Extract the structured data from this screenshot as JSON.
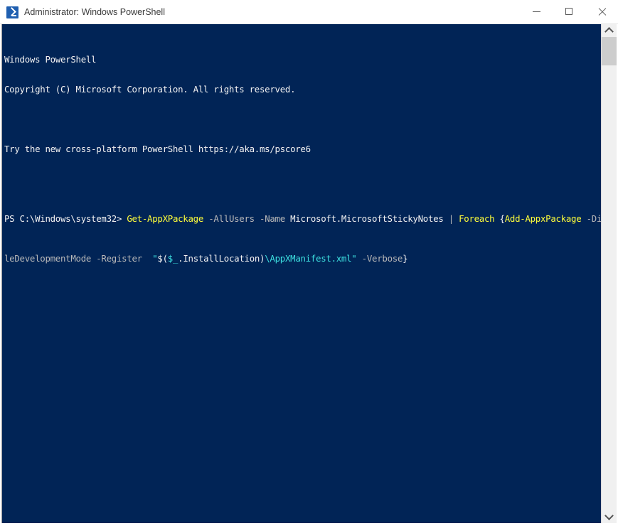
{
  "window": {
    "title": "Administrator: Windows PowerShell",
    "icon": "powershell-icon",
    "minimize_label": "—",
    "maximize_label": "□",
    "close_label": "✕",
    "background_color": "#012456",
    "titlebar_color": "#ffffff"
  },
  "console": {
    "banner": {
      "line1": "Windows PowerShell",
      "line2": "Copyright (C) Microsoft Corporation. All rights reserved.",
      "line3": "",
      "line4": "Try the new cross-platform PowerShell https://aka.ms/pscore6",
      "line5": ""
    },
    "prompt": "PS C:\\Windows\\system32>",
    "command_line1": {
      "seg1_cmdlet": "Get-AppXPackage",
      "seg2_params": "-AllUsers -Name",
      "seg3_value": "Microsoft.MicrosoftStickyNotes",
      "seg4_pipe": "|",
      "seg5_keyword": "Foreach",
      "seg6_brace": "{",
      "seg7_cmdlet": "Add-AppxPackage",
      "seg8_param_clipped": "-Disab"
    },
    "command_line2": {
      "seg1_param_wrap": "leDevelopmentMode -Register",
      "seg2_quote": "\"",
      "seg3_subexpr_open": "$(",
      "seg4_variable": "$_",
      "seg5_property": ".InstallLocation)",
      "seg6_path": "\\AppXManifest.xml\"",
      "seg7_param": "-Verbose",
      "seg8_brace": "}"
    },
    "colors": {
      "text": "#f2f2f2",
      "parameter": "#b9b9b9",
      "cmdlet": "#ffff3a",
      "string": "#3de0e0"
    }
  },
  "scrollbar": {
    "up_arrow": "scroll-up-arrow",
    "down_arrow": "scroll-down-arrow",
    "thumb": "scroll-thumb"
  }
}
